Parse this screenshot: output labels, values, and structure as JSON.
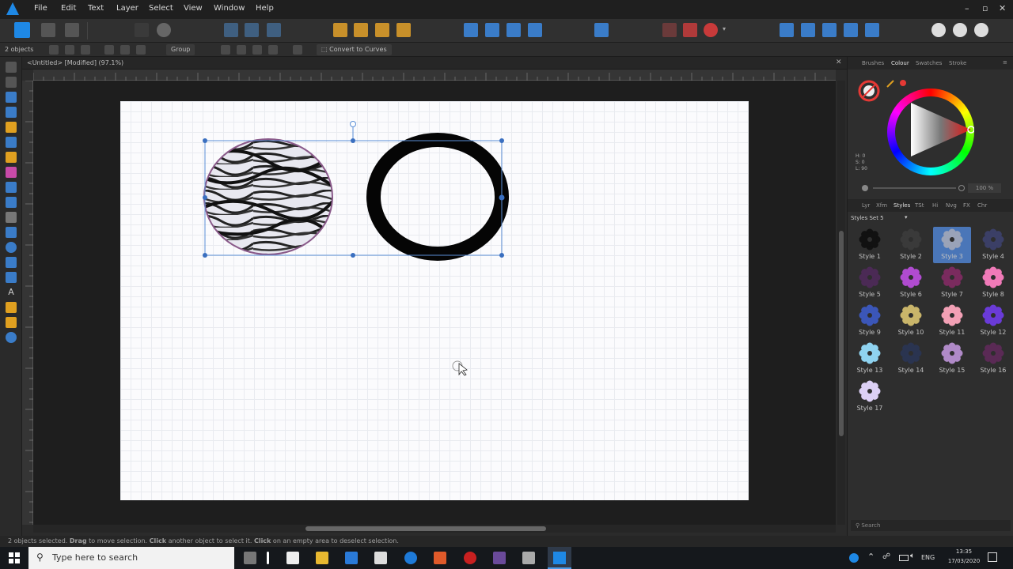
{
  "app": {
    "brand_color": "#1e88e5"
  },
  "menu": [
    "File",
    "Edit",
    "Text",
    "Layer",
    "Select",
    "View",
    "Window",
    "Help"
  ],
  "context": {
    "selection_count": "2 objects",
    "group_label": "Group",
    "convert_label": "Convert to Curves"
  },
  "document": {
    "tab_title": "<Untitled> [Modified] (97.1%)"
  },
  "right_panel": {
    "top_tabs": [
      "Brushes",
      "Colour",
      "Swatches",
      "Stroke"
    ],
    "colour": {
      "h": "H: 0",
      "s": "S: 0",
      "l": "L: 90",
      "opacity": "100 %"
    },
    "studio_tabs": [
      "Lyr",
      "Xfm",
      "Styles",
      "TSt",
      "Hi",
      "Nvg",
      "FX",
      "Chr"
    ],
    "styles_set": "Styles Set 5",
    "styles": [
      {
        "label": "Style 1",
        "color": "#111111"
      },
      {
        "label": "Style 2",
        "color": "#3a3a3a"
      },
      {
        "label": "Style 3",
        "color": "#9aa3b8",
        "selected": true
      },
      {
        "label": "Style 4",
        "color": "#3b3f66"
      },
      {
        "label": "Style 5",
        "color": "#4b2a55"
      },
      {
        "label": "Style 6",
        "color": "#b04bd0"
      },
      {
        "label": "Style 7",
        "color": "#7a2b5e"
      },
      {
        "label": "Style 8",
        "color": "#f07ab8"
      },
      {
        "label": "Style 9",
        "color": "#3b56b8"
      },
      {
        "label": "Style 10",
        "color": "#c9b56a"
      },
      {
        "label": "Style 11",
        "color": "#f2a0b5"
      },
      {
        "label": "Style 12",
        "color": "#6a3bd8"
      },
      {
        "label": "Style 13",
        "color": "#8fd3f0"
      },
      {
        "label": "Style 14",
        "color": "#2a3450"
      },
      {
        "label": "Style 15",
        "color": "#b08ac8"
      },
      {
        "label": "Style 16",
        "color": "#5a2a55"
      },
      {
        "label": "Style 17",
        "color": "#dcd0f5"
      }
    ],
    "search_placeholder": "Search"
  },
  "status": {
    "p1": "2 objects selected. ",
    "k1": "Drag",
    "p2": " to move selection. ",
    "k2": "Click",
    "p3": " another object to select it. ",
    "k3": "Click",
    "p4": " on an empty area to deselect selection."
  },
  "taskbar": {
    "search_placeholder": "Type here to search",
    "lang": "ENG",
    "time": "13:35",
    "date": "17/03/2020"
  }
}
